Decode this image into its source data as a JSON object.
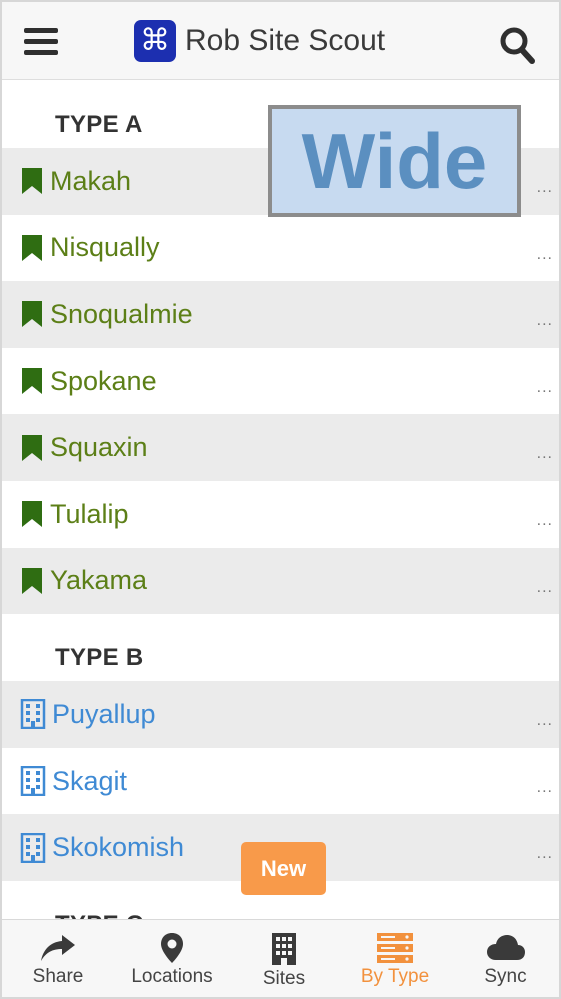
{
  "header": {
    "app_title": "Rob Site Scout",
    "logo_glyph": "⌘",
    "menu_icon": "hamburger-menu-icon",
    "search_icon": "search-icon"
  },
  "sections": [
    {
      "title": "TYPE A",
      "icon": "bookmark-icon",
      "color": "#5c7f17",
      "items": [
        "Makah",
        "Nisqually",
        "Snoqualmie",
        "Spokane",
        "Squaxin",
        "Tulalip",
        "Yakama"
      ]
    },
    {
      "title": "TYPE B",
      "icon": "building-icon",
      "color": "#3f8ad4",
      "items": [
        "Puyallup",
        "Skagit",
        "Skokomish"
      ]
    },
    {
      "title": "TYPE C",
      "items": []
    }
  ],
  "more_label": "...",
  "overlay": {
    "wide_label": "Wide",
    "new_label": "New"
  },
  "tabs": [
    {
      "label": "Share",
      "icon": "share-arrow-icon"
    },
    {
      "label": "Locations",
      "icon": "location-pin-icon"
    },
    {
      "label": "Sites",
      "icon": "building-icon"
    },
    {
      "label": "By Type",
      "icon": "server-stack-icon",
      "active": true
    },
    {
      "label": "Sync",
      "icon": "cloud-icon"
    }
  ],
  "colors": {
    "accent": "#f2913d",
    "type_a": "#5c7f17",
    "type_b": "#3f8ad4",
    "row_shade": "#ebebeb"
  }
}
